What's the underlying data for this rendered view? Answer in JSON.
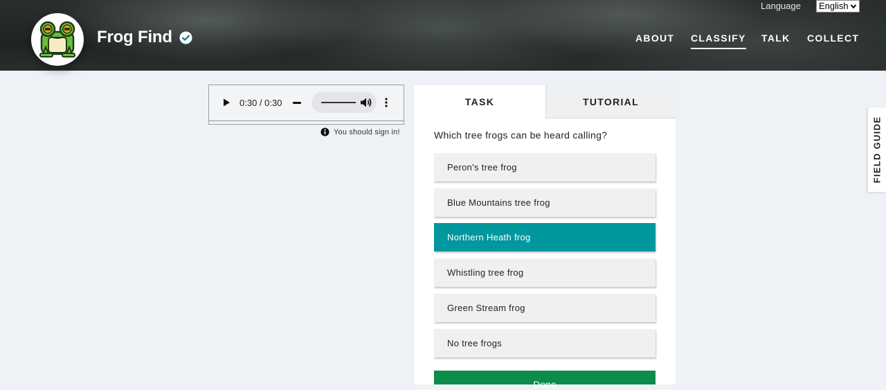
{
  "header": {
    "project_title": "Frog Find",
    "language_label": "Language",
    "language_selected": "English",
    "nav": [
      {
        "label": "ABOUT"
      },
      {
        "label": "CLASSIFY"
      },
      {
        "label": "TALK"
      },
      {
        "label": "COLLECT"
      }
    ],
    "active_nav": "CLASSIFY",
    "icons": {
      "logo": "frog-logo",
      "verified": "verified-check-icon"
    }
  },
  "audio": {
    "time": "0:30 / 0:30",
    "signin_notice": "You should sign in!",
    "icons": [
      "play-icon",
      "volume-icon",
      "more-options-icon",
      "info-icon"
    ]
  },
  "task_panel": {
    "tabs": [
      {
        "label": "TASK"
      },
      {
        "label": "TUTORIAL"
      }
    ],
    "active_tab": "TASK",
    "question": "Which tree frogs can be heard calling?",
    "answers": [
      {
        "label": "Peron's tree frog",
        "selected": false
      },
      {
        "label": "Blue Mountains tree frog",
        "selected": false
      },
      {
        "label": "Northern Heath frog",
        "selected": true
      },
      {
        "label": "Whistling tree frog",
        "selected": false
      },
      {
        "label": "Green Stream frog",
        "selected": false
      },
      {
        "label": "No tree frogs",
        "selected": false
      }
    ],
    "done_label": "Done"
  },
  "field_guide": {
    "label": "FIELD GUIDE"
  },
  "colors": {
    "selected_answer": "#00979d",
    "done_button": "#0b8c4a",
    "page_background": "#eef1f6"
  }
}
